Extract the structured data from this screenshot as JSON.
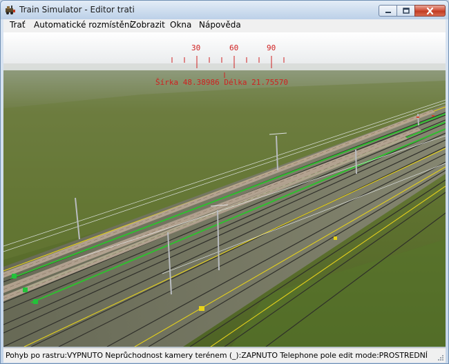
{
  "window": {
    "title": "Train Simulator - Editor trati"
  },
  "menu": {
    "items": [
      "Trať",
      "Automatické rozmístění",
      "Zobrazit",
      "Okna",
      "Nápověda"
    ]
  },
  "compass": {
    "ticks": [
      "30",
      "60",
      "90"
    ],
    "coordinates": "Šírka 48.38986 Délka 21.75570"
  },
  "status": {
    "text": "Pohyb po rastru:VYPNUTO Neprůchodnost kamery terénem (_):ZAPNUTO Telephone pole edit mode:PROSTREDNÍ"
  },
  "colors": {
    "overlay": "#d01f1f",
    "selected_track": "#2fbf2f",
    "track_marker": "#e6d21a"
  },
  "icons": {
    "app": "train-app-icon",
    "minimize": "minimize-icon",
    "maximize": "maximize-icon",
    "close": "close-icon"
  }
}
